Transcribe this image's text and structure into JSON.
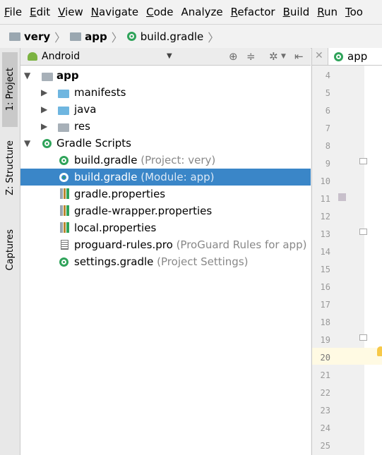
{
  "menu": {
    "items": [
      "File",
      "Edit",
      "View",
      "Navigate",
      "Code",
      "Analyze",
      "Refactor",
      "Build",
      "Run",
      "Too"
    ],
    "mnemonics": [
      "F",
      "E",
      "V",
      "N",
      "C",
      "",
      "R",
      "B",
      "R",
      "T"
    ]
  },
  "breadcrumb": {
    "items": [
      "very",
      "app",
      "build.gradle"
    ]
  },
  "side_tabs": {
    "project": "1: Project",
    "structure": "Z: Structure",
    "captures": "Captures"
  },
  "project_panel": {
    "view_mode": "Android",
    "tree": [
      {
        "label": "app",
        "bold": true
      },
      {
        "label": "manifests"
      },
      {
        "label": "java"
      },
      {
        "label": "res"
      },
      {
        "label": "Gradle Scripts"
      },
      {
        "label": "build.gradle",
        "hint": "(Project: very)"
      },
      {
        "label": "build.gradle",
        "hint": "(Module: app)",
        "selected": true
      },
      {
        "label": "gradle.properties"
      },
      {
        "label": "gradle-wrapper.properties"
      },
      {
        "label": "local.properties"
      },
      {
        "label": "proguard-rules.pro",
        "hint": "(ProGuard Rules for app)"
      },
      {
        "label": "settings.gradle",
        "hint": "(Project Settings)"
      }
    ]
  },
  "editor": {
    "tab_label": "app",
    "line_numbers": [
      "4",
      "5",
      "6",
      "7",
      "8",
      "9",
      "10",
      "11",
      "12",
      "13",
      "14",
      "15",
      "16",
      "17",
      "18",
      "19",
      "20",
      "21",
      "22",
      "23",
      "24",
      "25"
    ],
    "current_line": "20"
  },
  "colors": {
    "selection": "#3a86c8",
    "gradle_green": "#2fa35a",
    "folder_blue": "#6fb6e0",
    "current_line_bg": "#fffae3"
  }
}
